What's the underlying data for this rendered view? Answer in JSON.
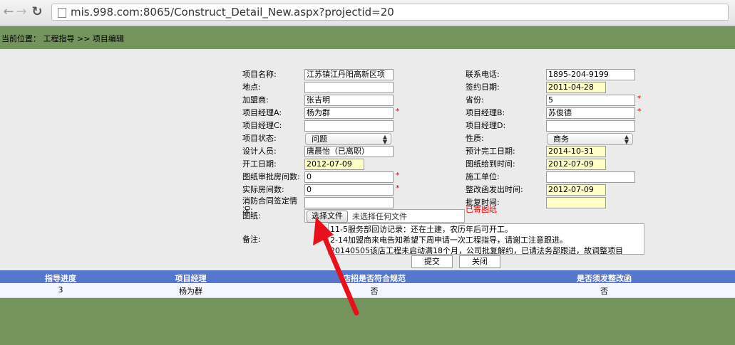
{
  "browser": {
    "url": "mis.998.com:8065/Construct_Detail_New.aspx?projectid=20"
  },
  "breadcrumb": "当前位置：  工程指导 >> 项目编辑",
  "form": {
    "left": [
      {
        "label": "项目名称:",
        "value": "江苏镇江丹阳高新区项",
        "style": "white"
      },
      {
        "label": "地点:",
        "value": "",
        "style": "white"
      },
      {
        "label": "加盟商:",
        "value": "张吉明",
        "style": "white"
      },
      {
        "label": "项目经理A:",
        "value": "杨为群",
        "style": "white",
        "required": true
      },
      {
        "label": "项目经理C:",
        "value": "",
        "style": "white"
      },
      {
        "label": "项目状态:",
        "value": "问题",
        "style": "select"
      },
      {
        "label": "设计人员:",
        "value": "唐晨怡（已离职）",
        "style": "white"
      },
      {
        "label": "开工日期:",
        "value": "2012-07-09",
        "style": "yellow"
      },
      {
        "label": "图纸审批房间数:",
        "value": "0",
        "style": "white",
        "required": true
      },
      {
        "label": "实际房间数:",
        "value": "0",
        "style": "white",
        "required": true
      },
      {
        "label": "消防合同签定情况:",
        "value": "",
        "style": "white"
      }
    ],
    "right": [
      {
        "label": "联系电话:",
        "value": "1895-204-9199",
        "style": "white"
      },
      {
        "label": "签约日期:",
        "value": "2011-04-28",
        "style": "yellow"
      },
      {
        "label": "省份:",
        "value": "5",
        "style": "white",
        "required": true
      },
      {
        "label": "项目经理B:",
        "value": "苏俊德",
        "style": "white",
        "required": true
      },
      {
        "label": "项目经理D:",
        "value": "",
        "style": "white"
      },
      {
        "label": "性质:",
        "value": "商务",
        "style": "select"
      },
      {
        "label": "预计完工日期:",
        "value": "2014-10-31",
        "style": "yellow"
      },
      {
        "label": "图纸给到时间:",
        "value": "2012-07-09",
        "style": "yellow"
      },
      {
        "label": "施工单位:",
        "value": "",
        "style": "white"
      },
      {
        "label": "整改函发出时间:",
        "value": "2012-07-09",
        "style": "yellow"
      },
      {
        "label": "批复时间:",
        "value": "",
        "style": "yellow"
      }
    ],
    "drawing_label": "图纸:",
    "file_button": "选择文件",
    "file_status": "未选择任何文件",
    "drawing_sent": "已寄图纸",
    "remarks_label": "备注:",
    "remarks": [
      "11-5服务部回访记录：还在土建，农历年后可开工。",
      "2-14加盟商来电告知希望下周申请一次工程指导，请谢工注意跟进。",
      "20140505该店工程未启动满18个月，公司批复解约，已请法务部跟进，故调整项目"
    ],
    "submit": "提交",
    "close": "关闭"
  },
  "table": {
    "headers": [
      "指导进度",
      "项目经理",
      "店招是否符合规范",
      "是否须发整改函"
    ],
    "rows": [
      [
        "3",
        "杨为群",
        "否",
        "否"
      ]
    ]
  },
  "colors": {
    "green_bar": "#73945d",
    "table_header": "#5577cc",
    "date_fill": "#ffffc6",
    "arrow": "#e8101a"
  }
}
